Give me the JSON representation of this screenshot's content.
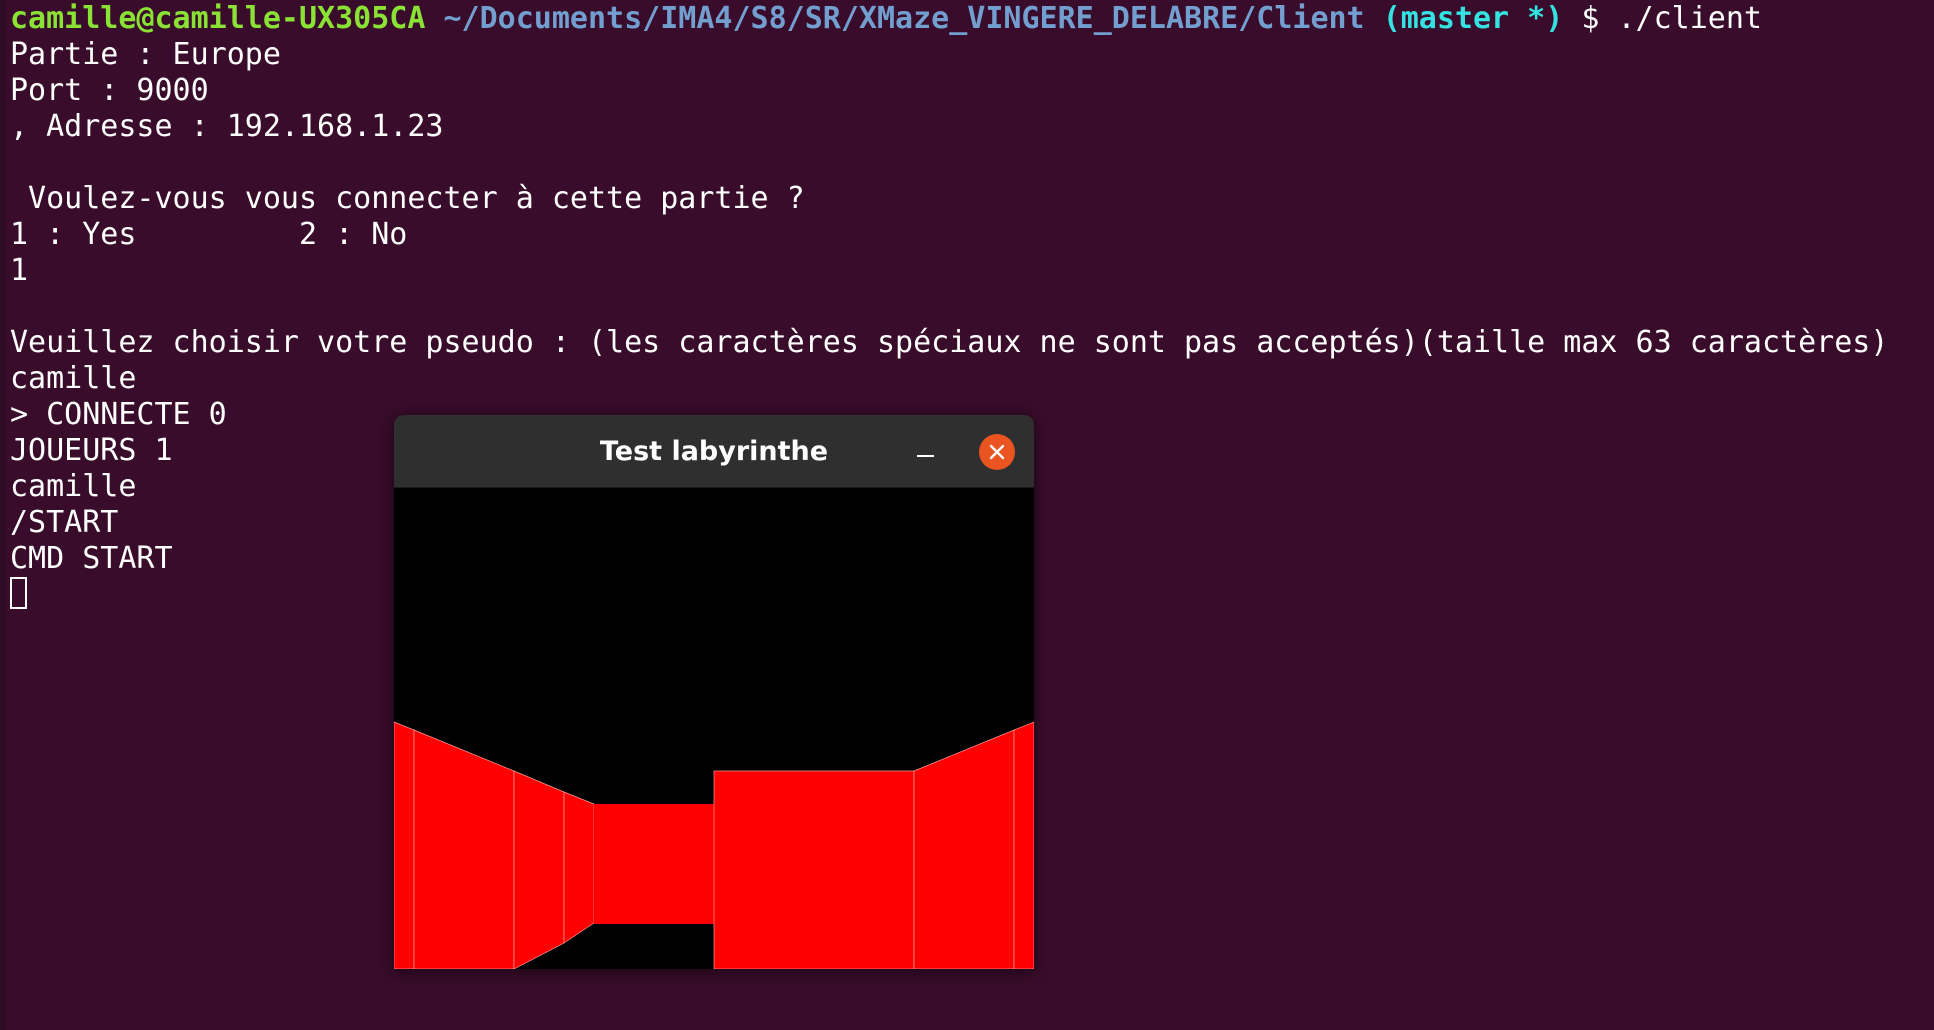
{
  "terminal": {
    "prompt": {
      "user_host": "camille@camille-UX305CA",
      "path": "~/Documents/IMA4/S8/SR/XMaze_VINGERE_DELABRE/Client",
      "branch": "(master *)",
      "symbol": "$",
      "command": "./client"
    },
    "lines": [
      "Partie : Europe",
      "Port : 9000",
      ", Adresse : 192.168.1.23",
      "",
      " Voulez-vous vous connecter à cette partie ?",
      "1 : Yes         2 : No",
      "1",
      "",
      "Veuillez choisir votre pseudo : (les caractères spéciaux ne sont pas acceptés)(taille max 63 caractères)",
      "camille",
      "> CONNECTE 0",
      "JOUEURS 1",
      "camille",
      "/START",
      "CMD START"
    ]
  },
  "window": {
    "title": "Test labyrinthe",
    "minimize_label": "–",
    "close_icon": "close-icon",
    "wall_color": "#ff0000",
    "background_color": "#000000",
    "close_color": "#e95420"
  },
  "colors": {
    "terminal_bg": "#380c2a",
    "user_host": "#8ae234",
    "path": "#729fcf",
    "branch": "#34e2e2"
  }
}
